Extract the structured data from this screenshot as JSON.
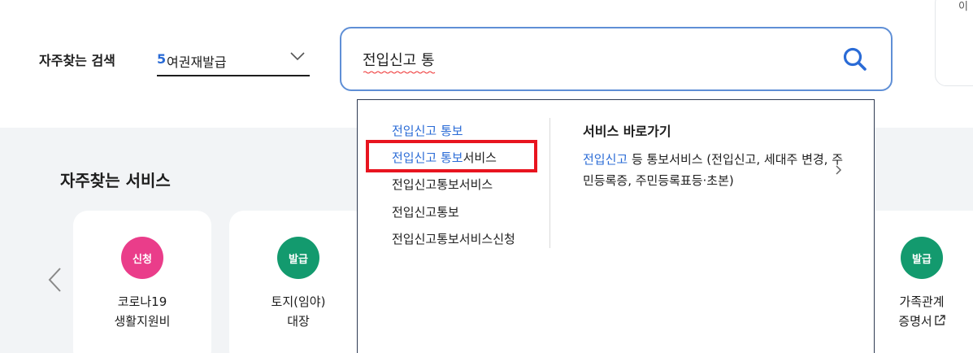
{
  "top_corner_text": "이",
  "frequent_search": {
    "label": "자주찾는 검색",
    "selected_number": "5",
    "selected_text": "여권재발급"
  },
  "search": {
    "value": "전입신고 통"
  },
  "services": {
    "title": "자주찾는 서비스",
    "cards": [
      {
        "badge": "신청",
        "badge_color": "#ea3d8a",
        "line1": "코로나19",
        "line2": "생활지원비"
      },
      {
        "badge": "발급",
        "badge_color": "#139a6e",
        "line1": "토지(임야)",
        "line2": "대장"
      },
      {
        "badge": "발급",
        "badge_color": "#139a6e",
        "line1": "가족관계",
        "line2": "증명서"
      }
    ]
  },
  "autocomplete": {
    "suggestions": [
      {
        "match": "전입신고 통보",
        "rest": ""
      },
      {
        "match": "전입신고 통보",
        "rest": "서비스"
      },
      {
        "match": "",
        "rest": "전입신고통보서비스"
      },
      {
        "match": "",
        "rest": "전입신고통보"
      },
      {
        "match": "",
        "rest": "전입신고통보서비스신청"
      }
    ],
    "shortcut_title": "서비스 바로가기",
    "shortcut_match": "전입신고",
    "shortcut_rest": " 등 통보서비스 (전입신고, 세대주 변경, 주민등록증, 주민등록표등·초본)"
  },
  "colors": {
    "accent": "#2a6bd6",
    "highlight_box": "#e8141f",
    "search_border": "#5f8fd6",
    "background_gray": "#f2f4f6"
  }
}
